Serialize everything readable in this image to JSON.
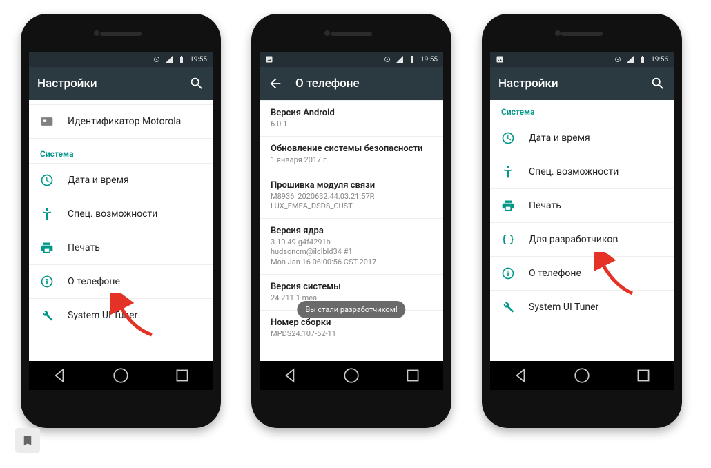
{
  "colors": {
    "accent": "#009688",
    "appbar": "#2b3a40",
    "status": "#232f34",
    "arrow": "#e53226"
  },
  "phone1": {
    "time": "19:55",
    "title": "Настройки",
    "motorola_row": "Идентификатор Motorola",
    "section_system": "Система",
    "items": [
      {
        "icon": "clock-icon",
        "label": "Дата и время"
      },
      {
        "icon": "accessibility-icon",
        "label": "Спец. возможности"
      },
      {
        "icon": "print-icon",
        "label": "Печать"
      },
      {
        "icon": "info-icon",
        "label": "О телефоне"
      },
      {
        "icon": "wrench-icon",
        "label": "System UI Tuner"
      }
    ]
  },
  "phone2": {
    "time": "19:55",
    "title": "О телефоне",
    "toast": "Вы стали разработчиком!",
    "rows": [
      {
        "title": "Версия Android",
        "sub": "6.0.1"
      },
      {
        "title": "Обновление системы безопасности",
        "sub": "1 января 2017 г."
      },
      {
        "title": "Прошивка модуля связи",
        "sub": "M8936_2020632.44.03.21.57R\nLUX_EMEA_DSDS_CUST"
      },
      {
        "title": "Версия ядра",
        "sub": "3.10.49-g4f4291b\nhudsoncm@ilclbld34 #1\nMon Jan 16 06:00:56 CST 2017"
      },
      {
        "title": "Версия системы",
        "sub": "24.211.1                                                  mea"
      },
      {
        "title": "Номер сборки",
        "sub": "MPDS24.107-52-11"
      }
    ]
  },
  "phone3": {
    "time": "19:56",
    "title": "Настройки",
    "section_system": "Система",
    "items": [
      {
        "icon": "clock-icon",
        "label": "Дата и время"
      },
      {
        "icon": "accessibility-icon",
        "label": "Спец. возможности"
      },
      {
        "icon": "print-icon",
        "label": "Печать"
      },
      {
        "icon": "braces-icon",
        "label": "Для разработчиков"
      },
      {
        "icon": "info-icon",
        "label": "О телефоне"
      },
      {
        "icon": "wrench-icon",
        "label": "System UI Tuner"
      }
    ]
  }
}
